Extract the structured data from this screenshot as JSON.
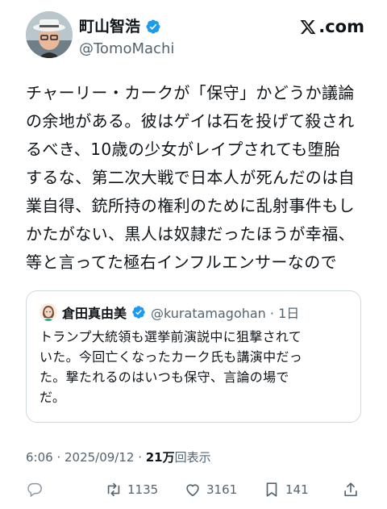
{
  "author": {
    "display_name": "町山智浩",
    "handle": "@TomoMachi"
  },
  "brand": {
    "text": ".com",
    "logo_icon": "x-logo-icon"
  },
  "tweet": {
    "text": "チャーリー・カークが「保守」かどうか議論\nの余地がある。彼はゲイは石を投げて殺され\nるべき、10歳の少女がレイプされても堕胎\nするな、第二次大戦で日本人が死んだのは自\n業自得、銃所持の権利のために乱射事件もし\nかたがない、黒人は奴隷だったほうが幸福、\n等と言ってた極右インフルエンサーなので"
  },
  "quote": {
    "display_name": "倉田真由美",
    "handle_date": "@kuratamagohan · 1日",
    "text": "トランプ大統領も選挙前演説中に狙撃されて\nいた。今回亡くなったカーク氏も講演中だっ\nた。撃たれるのはいつも保守、言論の場で\nだ。"
  },
  "meta": {
    "timestamp": "6:06 · 2025/09/12 · ",
    "views_count": "21万",
    "views_label": "回表示"
  },
  "actions": {
    "reply_count": "",
    "retweet_count": "1135",
    "like_count": "3161",
    "bookmark_count": "141"
  },
  "colors": {
    "verified": "#1d9bf0",
    "text": "#0f1419",
    "muted": "#536471",
    "border": "#cfd9de"
  }
}
